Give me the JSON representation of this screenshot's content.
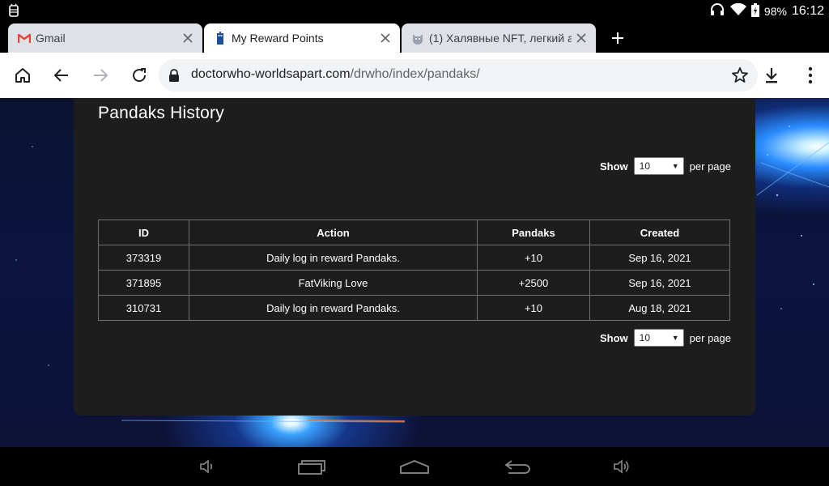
{
  "status_bar": {
    "battery": "98%",
    "time": "16:12",
    "icons": [
      "android-debug-icon",
      "headset-icon",
      "wifi-icon",
      "battery-icon"
    ]
  },
  "tabs": [
    {
      "title": "Gmail",
      "favicon": "gmail-icon",
      "active": false
    },
    {
      "title": "My Reward Points",
      "favicon": "tardis-icon",
      "active": true
    },
    {
      "title": "(1) Халявные NFT, легкий а",
      "favicon": "cat-face-icon",
      "active": false
    }
  ],
  "toolbar": {
    "url_domain": "doctorwho-worldsapart.com",
    "url_path": "/drwho/index/pandaks/"
  },
  "page": {
    "title": "Pandaks History",
    "per_page": {
      "show_label": "Show",
      "value": "10",
      "suffix": "per page"
    },
    "table": {
      "headers": [
        "ID",
        "Action",
        "Pandaks",
        "Created"
      ],
      "rows": [
        [
          "373319",
          "Daily log in reward Pandaks.",
          "+10",
          "Sep 16, 2021"
        ],
        [
          "371895",
          "FatViking Love",
          "+2500",
          "Sep 16, 2021"
        ],
        [
          "310731",
          "Daily log in reward Pandaks.",
          "+10",
          "Aug 18, 2021"
        ]
      ]
    }
  },
  "colors": {
    "card_bg": "#1d1d1d",
    "table_border": "#707070",
    "active_tab": "#ffffff",
    "inactive_tab": "#dee1e6"
  }
}
